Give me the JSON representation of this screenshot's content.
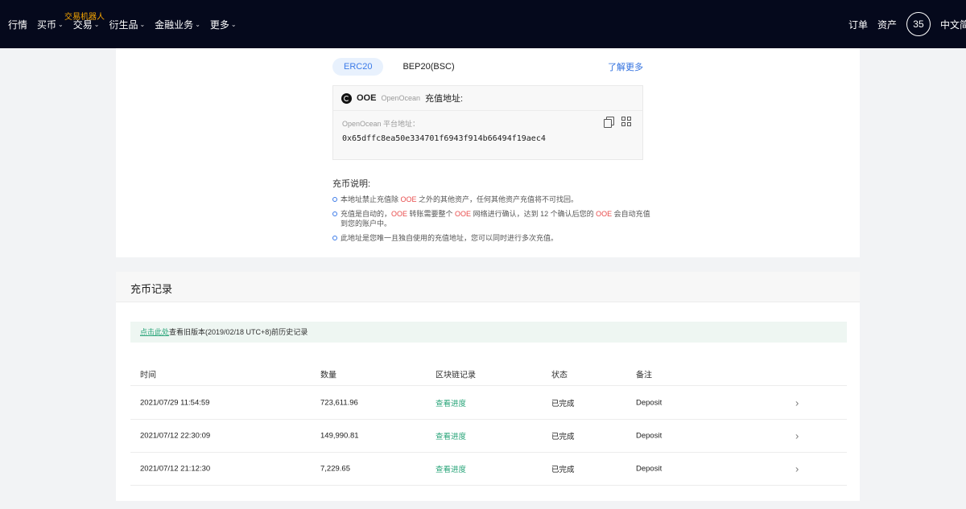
{
  "nav": {
    "items": [
      {
        "label": "行情",
        "has_chevron": false
      },
      {
        "label": "买币",
        "has_chevron": true
      },
      {
        "label": "交易",
        "has_chevron": true
      },
      {
        "label": "衍生品",
        "has_chevron": true
      },
      {
        "label": "金融业务",
        "has_chevron": true
      },
      {
        "label": "更多",
        "has_chevron": true
      }
    ],
    "badge": "交易机器人",
    "right": {
      "orders": "订单",
      "assets": "资产",
      "avatar_text": "35",
      "language": "中文简体"
    }
  },
  "deposit": {
    "tabs": [
      {
        "label": "ERC20",
        "active": true
      },
      {
        "label": "BEP20(BSC)",
        "active": false
      }
    ],
    "learn_more": "了解更多",
    "coin_symbol": "OOE",
    "coin_name": "OpenOcean",
    "address_title": "充值地址:",
    "address_label": "OpenOcean 平台地址：",
    "address": "0x65dffc8ea50e334701f6943f914b66494f19aec4",
    "notes_title": "充币说明:",
    "notes": [
      {
        "pre": "本地址禁止充值除 ",
        "hl": "OOE",
        "post": " 之外的其他资产，任何其他资产充值将不可找回。"
      },
      {
        "pre": "充值是自动的，",
        "hl": "OOE",
        "mid1": " 转账需要整个 ",
        "hl2": "OOE",
        "mid2": " 网络进行确认，达到 12 个确认后您的 ",
        "hl3": "OOE",
        "post": " 会自动充值到您的账户中。"
      },
      {
        "pre": "此地址是您唯一且独自使用的充值地址，您可以同时进行多次充值。"
      }
    ]
  },
  "records": {
    "title": "充币记录",
    "banner_link": "点击此处",
    "banner_text": "查看旧版本(2019/02/18 UTC+8)前历史记录",
    "columns": [
      "时间",
      "数量",
      "区块链记录",
      "状态",
      "备注"
    ],
    "rows": [
      {
        "time": "2021/07/29 11:54:59",
        "amount": "723,611.96",
        "chain": "查看进度",
        "status": "已完成",
        "note": "Deposit"
      },
      {
        "time": "2021/07/12 22:30:09",
        "amount": "149,990.81",
        "chain": "查看进度",
        "status": "已完成",
        "note": "Deposit"
      },
      {
        "time": "2021/07/12 21:12:30",
        "amount": "7,229.65",
        "chain": "查看进度",
        "status": "已完成",
        "note": "Deposit"
      }
    ],
    "colors": {
      "accent_green": "#2aa57a",
      "highlight_red": "#e84c4c",
      "accent_blue": "#3b7ae8"
    }
  }
}
